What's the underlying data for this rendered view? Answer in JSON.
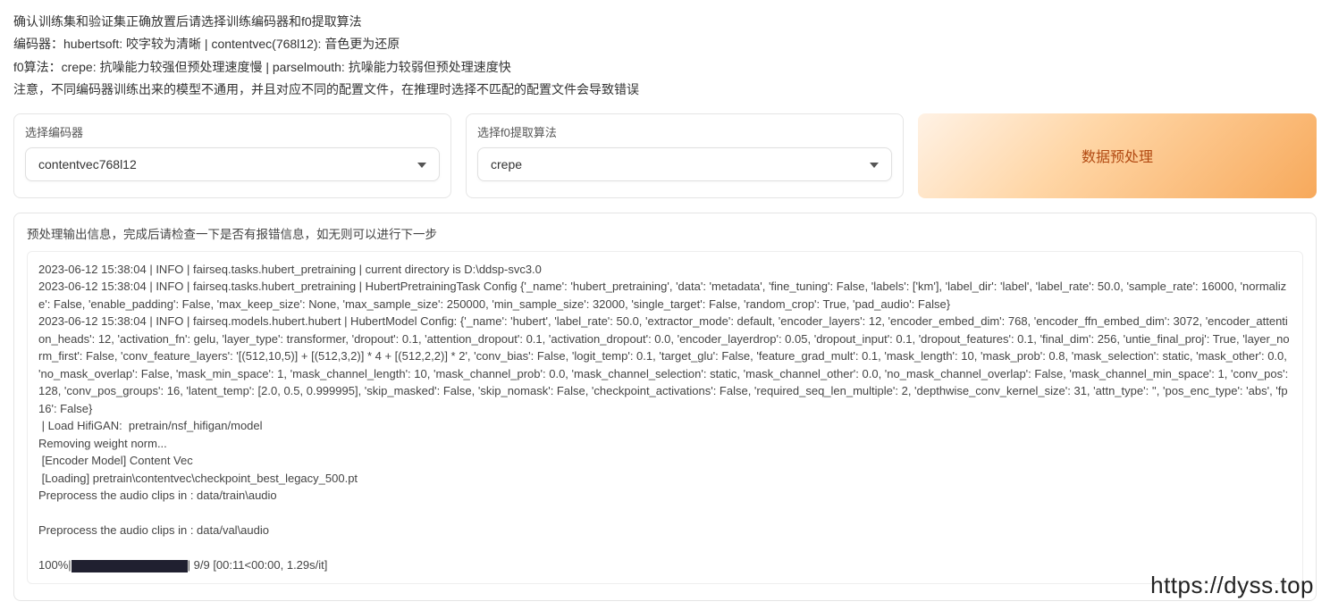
{
  "info": {
    "line1": "确认训练集和验证集正确放置后请选择训练编码器和f0提取算法",
    "line2": "编码器：hubertsoft: 咬字较为清晰 | contentvec(768l12): 音色更为还原",
    "line3": "f0算法：crepe: 抗噪能力较强但预处理速度慢 | parselmouth: 抗噪能力较弱但预处理速度快",
    "line4": "注意，不同编码器训练出来的模型不通用，并且对应不同的配置文件，在推理时选择不匹配的配置文件会导致错误"
  },
  "encoder": {
    "label": "选择编码器",
    "value": "contentvec768l12"
  },
  "f0": {
    "label": "选择f0提取算法",
    "value": "crepe"
  },
  "run_button": "数据预处理",
  "output": {
    "label": "预处理输出信息，完成后请检查一下是否有报错信息，如无则可以进行下一步",
    "log_pre": "2023-06-12 15:38:04 | INFO | fairseq.tasks.hubert_pretraining | current directory is D:\\ddsp-svc3.0\n2023-06-12 15:38:04 | INFO | fairseq.tasks.hubert_pretraining | HubertPretrainingTask Config {'_name': 'hubert_pretraining', 'data': 'metadata', 'fine_tuning': False, 'labels': ['km'], 'label_dir': 'label', 'label_rate': 50.0, 'sample_rate': 16000, 'normalize': False, 'enable_padding': False, 'max_keep_size': None, 'max_sample_size': 250000, 'min_sample_size': 32000, 'single_target': False, 'random_crop': True, 'pad_audio': False}\n2023-06-12 15:38:04 | INFO | fairseq.models.hubert.hubert | HubertModel Config: {'_name': 'hubert', 'label_rate': 50.0, 'extractor_mode': default, 'encoder_layers': 12, 'encoder_embed_dim': 768, 'encoder_ffn_embed_dim': 3072, 'encoder_attention_heads': 12, 'activation_fn': gelu, 'layer_type': transformer, 'dropout': 0.1, 'attention_dropout': 0.1, 'activation_dropout': 0.0, 'encoder_layerdrop': 0.05, 'dropout_input': 0.1, 'dropout_features': 0.1, 'final_dim': 256, 'untie_final_proj': True, 'layer_norm_first': False, 'conv_feature_layers': '[(512,10,5)] + [(512,3,2)] * 4 + [(512,2,2)] * 2', 'conv_bias': False, 'logit_temp': 0.1, 'target_glu': False, 'feature_grad_mult': 0.1, 'mask_length': 10, 'mask_prob': 0.8, 'mask_selection': static, 'mask_other': 0.0, 'no_mask_overlap': False, 'mask_min_space': 1, 'mask_channel_length': 10, 'mask_channel_prob': 0.0, 'mask_channel_selection': static, 'mask_channel_other': 0.0, 'no_mask_channel_overlap': False, 'mask_channel_min_space': 1, 'conv_pos': 128, 'conv_pos_groups': 16, 'latent_temp': [2.0, 0.5, 0.999995], 'skip_masked': False, 'skip_nomask': False, 'checkpoint_activations': False, 'required_seq_len_multiple': 2, 'depthwise_conv_kernel_size': 31, 'attn_type': '', 'pos_enc_type': 'abs', 'fp16': False}\n | Load HifiGAN:  pretrain/nsf_hifigan/model\nRemoving weight norm...\n [Encoder Model] Content Vec\n [Loading] pretrain\\contentvec\\checkpoint_best_legacy_500.pt\nPreprocess the audio clips in : data/train\\audio\n\nPreprocess the audio clips in : data/val\\audio\n",
    "progress_prefix": "100%|",
    "progress_suffix": "| 9/9 [00:11<00:00, 1.29s/it]"
  },
  "watermark": "https://dyss.top"
}
